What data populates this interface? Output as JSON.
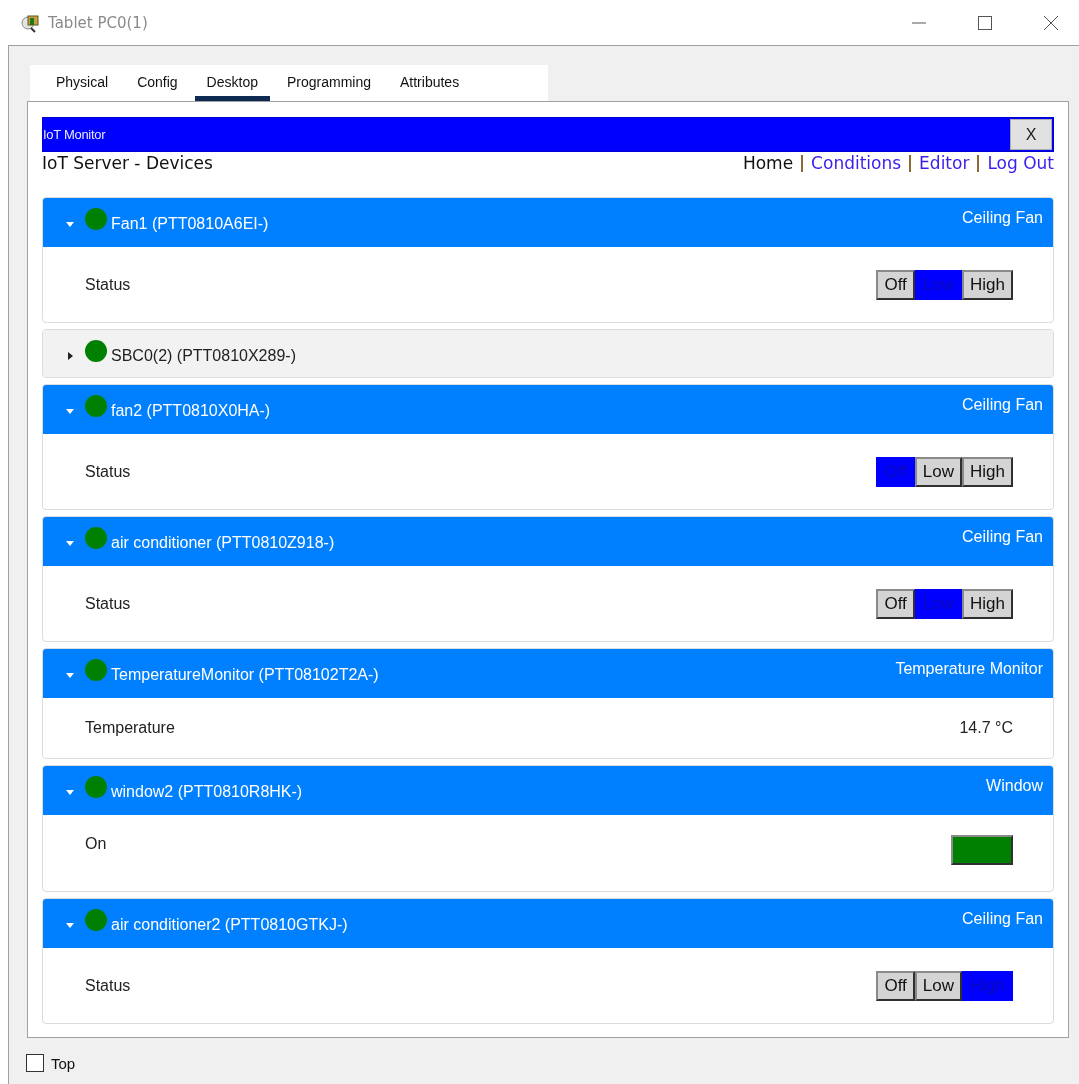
{
  "window": {
    "title": "Tablet PC0(1)"
  },
  "tabs": [
    {
      "label": "Physical",
      "selected": false
    },
    {
      "label": "Config",
      "selected": false
    },
    {
      "label": "Desktop",
      "selected": true
    },
    {
      "label": "Programming",
      "selected": false
    },
    {
      "label": "Attributes",
      "selected": false
    }
  ],
  "app": {
    "title": "IoT Monitor",
    "close_label": "X",
    "heading": "IoT Server - Devices",
    "nav": [
      {
        "label": "Home",
        "kind": "current"
      },
      {
        "label": "Conditions",
        "kind": "link"
      },
      {
        "label": "Editor",
        "kind": "link"
      },
      {
        "label": "Log Out",
        "kind": "link"
      }
    ]
  },
  "devices": [
    {
      "name": "Fan1 (PTT0810A6EI-)",
      "type": "Ceiling Fan",
      "online": true,
      "expanded": true,
      "body": {
        "kind": "switch",
        "label": "Status",
        "options": [
          {
            "label": "Off",
            "selected": false
          },
          {
            "label": "Low",
            "selected": true
          },
          {
            "label": "High",
            "selected": false
          }
        ]
      }
    },
    {
      "name": "SBC0(2) (PTT0810X289-)",
      "online": true,
      "expanded": false
    },
    {
      "name": "fan2 (PTT0810X0HA-)",
      "type": "Ceiling Fan",
      "online": true,
      "expanded": true,
      "body": {
        "kind": "switch",
        "label": "Status",
        "options": [
          {
            "label": "Off",
            "selected": true
          },
          {
            "label": "Low",
            "selected": false
          },
          {
            "label": "High",
            "selected": false
          }
        ]
      }
    },
    {
      "name": "air conditioner (PTT0810Z918-)",
      "type": "Ceiling Fan",
      "online": true,
      "expanded": true,
      "body": {
        "kind": "switch",
        "label": "Status",
        "options": [
          {
            "label": "Off",
            "selected": false
          },
          {
            "label": "Low",
            "selected": true
          },
          {
            "label": "High",
            "selected": false
          }
        ]
      }
    },
    {
      "name": "TemperatureMonitor (PTT08102T2A-)",
      "type": "Temperature Monitor",
      "online": true,
      "expanded": true,
      "body": {
        "kind": "reading",
        "label": "Temperature",
        "value": "14.7 °C"
      }
    },
    {
      "name": "window2 (PTT0810R8HK-)",
      "type": "Window",
      "online": true,
      "expanded": true,
      "body": {
        "kind": "indicator",
        "label": "On",
        "on": true
      }
    },
    {
      "name": "air conditioner2 (PTT0810GTKJ-)",
      "type": "Ceiling Fan",
      "online": true,
      "expanded": true,
      "body": {
        "kind": "switch",
        "label": "Status",
        "options": [
          {
            "label": "Off",
            "selected": false
          },
          {
            "label": "Low",
            "selected": false
          },
          {
            "label": "High",
            "selected": true
          }
        ]
      }
    }
  ],
  "footer": {
    "checkbox": {
      "label": "Top",
      "checked": false
    }
  }
}
